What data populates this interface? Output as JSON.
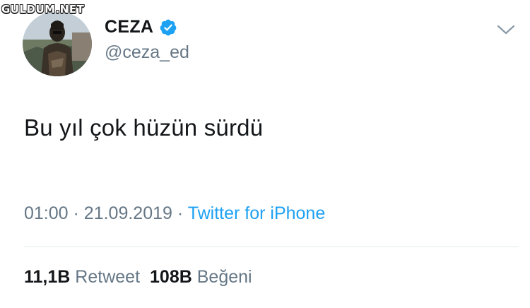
{
  "watermark": {
    "text": "GULDUM.NET"
  },
  "tweet": {
    "author": {
      "display_name": "CEZA",
      "handle": "@ceza_ed",
      "verified": true,
      "avatar_icon": "profile-photo"
    },
    "text": "Bu yıl çok hüzün sürdü",
    "time": "01:00",
    "separator": "·",
    "date": "21.09.2019",
    "source": "Twitter for iPhone",
    "stats": {
      "retweets_count": "11,1B",
      "retweets_label": "Retweet",
      "likes_count": "108B",
      "likes_label": "Beğeni"
    }
  },
  "icons": {
    "verified": "verified-badge-icon",
    "menu": "chevron-down-icon"
  },
  "colors": {
    "text_primary": "#14171a",
    "text_secondary": "#657786",
    "link": "#1da1f2",
    "verified_badge": "#1da1f2",
    "divider": "#e1e8ed",
    "background": "#ffffff"
  }
}
